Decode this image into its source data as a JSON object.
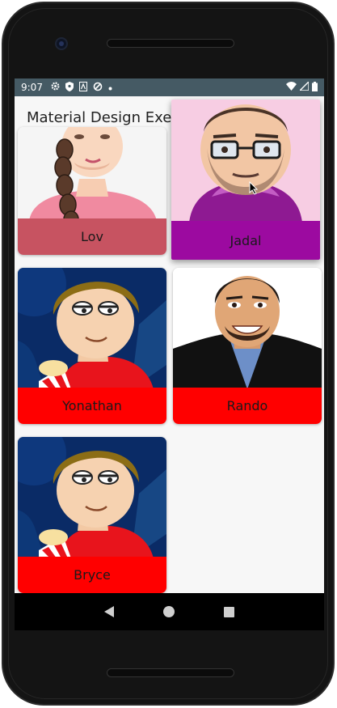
{
  "status_bar": {
    "time": "9:07",
    "left_icons": [
      "gear-icon",
      "shield-icon",
      "a-icon",
      "sync-icon",
      "dot-icon"
    ],
    "right_icons": [
      "wifi-icon",
      "signal-icon",
      "battery-icon"
    ]
  },
  "app_bar": {
    "title": "Material Design Exerc"
  },
  "grid": {
    "cards": [
      {
        "name": "Lov",
        "label_color": "#c75361"
      },
      {
        "name": "Jadal",
        "label_color": "#9c0aa0"
      },
      {
        "name": "Yonathan",
        "label_color": "#ff0000"
      },
      {
        "name": "Rando",
        "label_color": "#ff0000"
      },
      {
        "name": "Bryce",
        "label_color": "#ff0000"
      }
    ]
  },
  "nav_bar": {
    "buttons": [
      "back-icon",
      "home-icon",
      "recents-icon"
    ]
  }
}
